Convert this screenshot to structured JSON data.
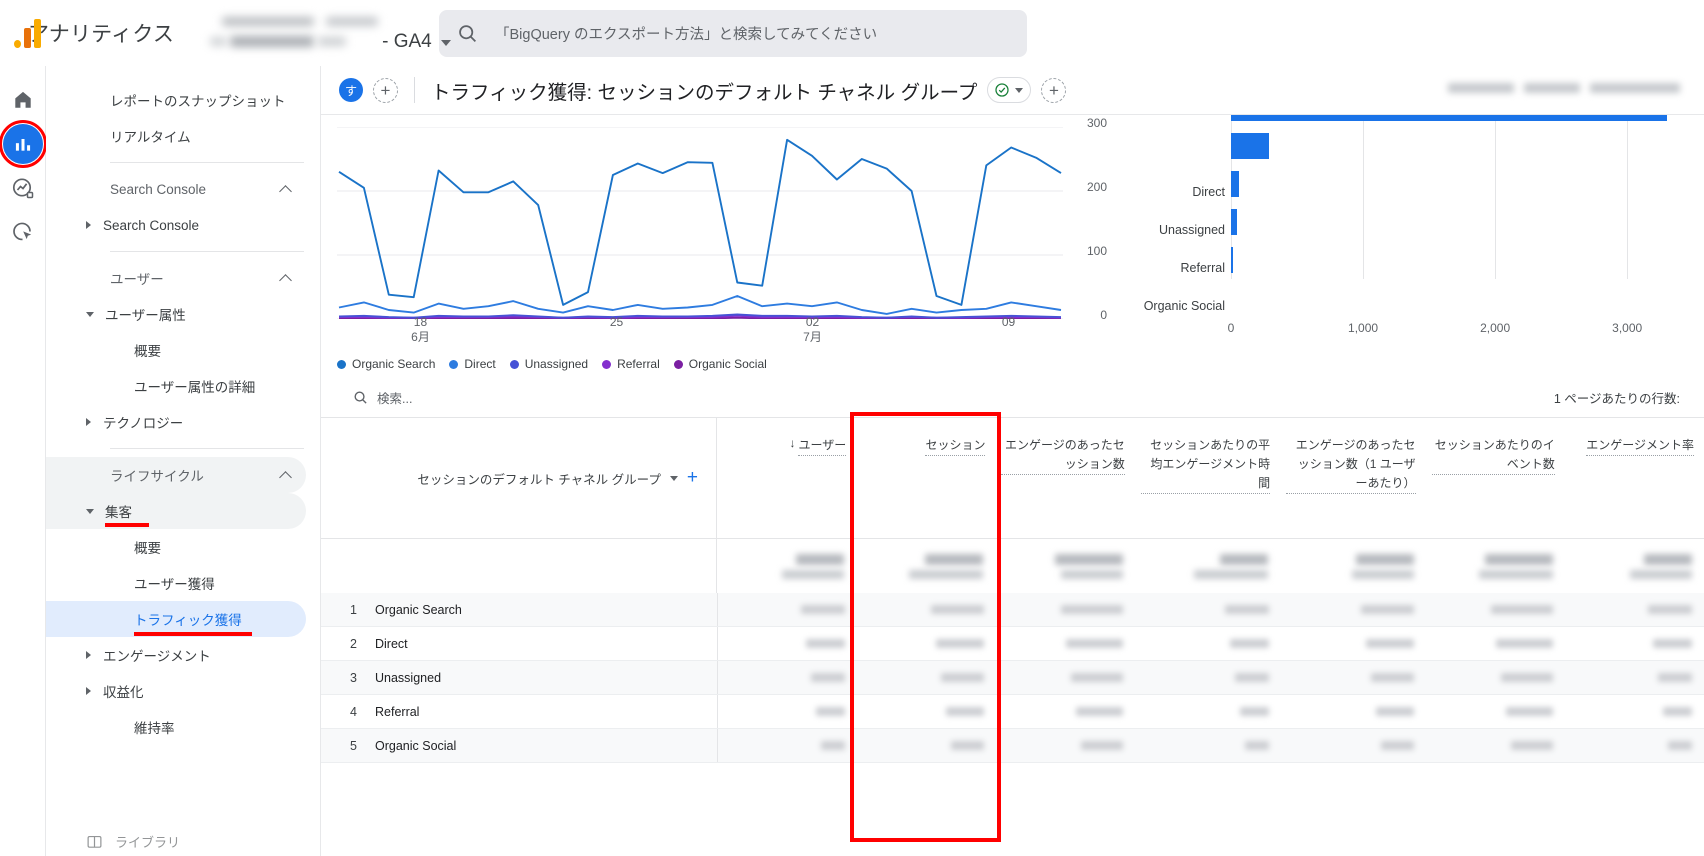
{
  "header": {
    "brand_title": "アナリティクス",
    "property_suffix": "- GA4",
    "search_placeholder": "「BigQuery のエクスポート方法」と検索してみてください",
    "search_icon": "search-icon"
  },
  "rail": {
    "items": [
      {
        "name": "home-icon",
        "label": "ホーム"
      },
      {
        "name": "reports-icon",
        "label": "レポート",
        "active": true,
        "annotated": true
      },
      {
        "name": "explore-icon",
        "label": "探索"
      },
      {
        "name": "advertising-icon",
        "label": "広告"
      }
    ]
  },
  "sidebar": {
    "items": [
      {
        "label": "レポートのスナップショット",
        "type": "item"
      },
      {
        "label": "リアルタイム",
        "type": "item"
      },
      {
        "label": "Search Console",
        "type": "section"
      },
      {
        "label": "Search Console",
        "type": "group"
      },
      {
        "label": "ユーザー",
        "type": "section"
      },
      {
        "label": "ユーザー属性",
        "type": "group-open"
      },
      {
        "label": "概要",
        "type": "sub"
      },
      {
        "label": "ユーザー属性の詳細",
        "type": "sub"
      },
      {
        "label": "テクノロジー",
        "type": "group"
      },
      {
        "label": "ライフサイクル",
        "type": "section"
      },
      {
        "label": "集客",
        "type": "group-open",
        "underline": true
      },
      {
        "label": "概要",
        "type": "sub"
      },
      {
        "label": "ユーザー獲得",
        "type": "sub"
      },
      {
        "label": "トラフィック獲得",
        "type": "sub",
        "active": true,
        "underline": true
      },
      {
        "label": "エンゲージメント",
        "type": "group"
      },
      {
        "label": "収益化",
        "type": "group"
      },
      {
        "label": "維持率",
        "type": "sub-plain"
      }
    ],
    "bottom_label": "ライブラリ"
  },
  "report": {
    "chip_label": "す",
    "add_comparison_label": "+",
    "title": "トラフィック獲得: セッションのデフォルト チャネル グループ",
    "badge_icon": "check-circle-icon",
    "add_icon": "plus-icon"
  },
  "table": {
    "search_placeholder": "検索...",
    "rows_per_page_label": "1 ページあたりの行数:",
    "dimension_header": "セッションのデフォルト チャネル グループ",
    "metric_headers": [
      {
        "label": "ユーザー",
        "sorted": true,
        "sort_arrow": "↓"
      },
      {
        "label": "セッション",
        "annotated": true
      },
      {
        "label": "エンゲージのあったセッション数"
      },
      {
        "label": "セッションあたりの平均エンゲージメント時間"
      },
      {
        "label": "エンゲージのあったセッション数（1 ユーザーあたり）"
      },
      {
        "label": "セッションあたりのイベント数"
      },
      {
        "label": "エンゲージメント率"
      }
    ],
    "rows": [
      {
        "index": "1",
        "name": "Organic Search"
      },
      {
        "index": "2",
        "name": "Direct"
      },
      {
        "index": "3",
        "name": "Unassigned"
      },
      {
        "index": "4",
        "name": "Referral"
      },
      {
        "index": "5",
        "name": "Organic Social"
      }
    ]
  },
  "chart_data": [
    {
      "type": "line",
      "title": "",
      "xlabel": "",
      "ylabel": "",
      "ylim": [
        0,
        300
      ],
      "yticks": [
        0,
        100,
        200,
        300
      ],
      "grid": true,
      "legend_position": "bottom",
      "xticks": [
        {
          "pos": 0.115,
          "label": "18",
          "sublabel": "6月"
        },
        {
          "pos": 0.385,
          "label": "25",
          "sublabel": ""
        },
        {
          "pos": 0.655,
          "label": "02",
          "sublabel": "7月"
        },
        {
          "pos": 0.925,
          "label": "09",
          "sublabel": ""
        }
      ],
      "series": [
        {
          "name": "Organic Search",
          "color": "#1a73c8",
          "values": [
            230,
            205,
            38,
            34,
            232,
            198,
            198,
            215,
            178,
            22,
            42,
            225,
            243,
            228,
            245,
            244,
            57,
            52,
            280,
            255,
            218,
            250,
            235,
            200,
            36,
            22,
            240,
            268,
            252,
            228
          ]
        },
        {
          "name": "Direct",
          "color": "#2e7ce0",
          "values": [
            18,
            26,
            14,
            10,
            24,
            16,
            20,
            28,
            16,
            10,
            20,
            14,
            22,
            16,
            18,
            22,
            36,
            20,
            24,
            20,
            26,
            14,
            8,
            16,
            10,
            14,
            16,
            26,
            20,
            14
          ]
        },
        {
          "name": "Unassigned",
          "color": "#4752d6",
          "values": [
            4,
            5,
            3,
            2,
            5,
            4,
            4,
            6,
            4,
            2,
            4,
            3,
            5,
            4,
            4,
            5,
            7,
            5,
            5,
            4,
            5,
            3,
            2,
            4,
            2,
            3,
            4,
            5,
            4,
            3
          ]
        },
        {
          "name": "Referral",
          "color": "#8430ce",
          "values": [
            3,
            3,
            2,
            2,
            3,
            3,
            3,
            4,
            3,
            2,
            3,
            2,
            3,
            3,
            3,
            3,
            5,
            3,
            3,
            3,
            3,
            2,
            2,
            3,
            2,
            2,
            3,
            3,
            3,
            2
          ]
        },
        {
          "name": "Organic Social",
          "color": "#7b1fa2",
          "values": [
            1,
            1,
            1,
            1,
            1,
            1,
            1,
            1,
            1,
            1,
            1,
            1,
            1,
            1,
            1,
            1,
            2,
            1,
            1,
            1,
            1,
            1,
            1,
            1,
            1,
            1,
            1,
            1,
            1,
            1
          ]
        }
      ]
    },
    {
      "type": "bar",
      "orientation": "horizontal",
      "title": "",
      "xlim": [
        0,
        3400
      ],
      "xticks": [
        0,
        1000,
        2000,
        3000
      ],
      "xtick_labels": [
        "0",
        "1,000",
        "2,000",
        "3,000"
      ],
      "categories": [
        "Organic Search",
        "Direct",
        "Unassigned",
        "Referral",
        "Organic Social"
      ],
      "values": [
        3300,
        290,
        60,
        45,
        5
      ],
      "bar_color": "#1a73e8",
      "visible_labels": [
        "Direct",
        "Unassigned",
        "Referral",
        "Organic Social"
      ]
    }
  ],
  "annotations": {
    "color": "#ff0000",
    "items": [
      {
        "name": "reports-icon-circle",
        "shape": "circle"
      },
      {
        "name": "acquisition-underline",
        "shape": "underline"
      },
      {
        "name": "traffic-acquisition-underline",
        "shape": "underline"
      },
      {
        "name": "sessions-column-box",
        "shape": "box"
      }
    ]
  }
}
